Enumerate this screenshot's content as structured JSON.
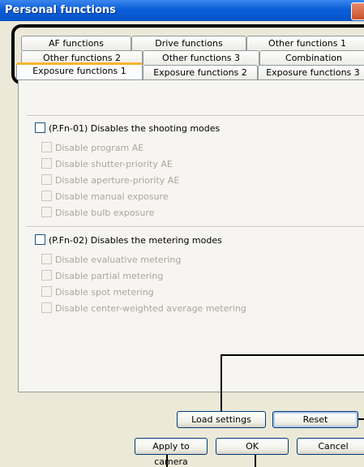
{
  "window": {
    "title": "Personal functions"
  },
  "tabs": {
    "row1": [
      "AF functions",
      "Drive functions",
      "Other functions 1"
    ],
    "row2": [
      "Other functions 2",
      "Other functions 3",
      "Combination"
    ],
    "row3": [
      "Exposure functions 1",
      "Exposure functions 2",
      "Exposure functions 3"
    ],
    "active": "Exposure functions 1"
  },
  "groups": [
    {
      "label": "(P.Fn-01) Disables the shooting modes",
      "checked": false,
      "options": [
        "Disable program AE",
        "Disable shutter-priority AE",
        "Disable aperture-priority AE",
        "Disable manual exposure",
        "Disable bulb exposure"
      ]
    },
    {
      "label": "(P.Fn-02) Disables the metering modes",
      "checked": false,
      "options": [
        "Disable evaluative metering",
        "Disable partial metering",
        "Disable spot metering",
        "Disable center-weighted average metering"
      ]
    }
  ],
  "buttons": {
    "load_settings": "Load settings",
    "reset": "Reset",
    "apply_to_camera": "Apply to camera",
    "ok": "OK",
    "cancel": "Cancel"
  }
}
